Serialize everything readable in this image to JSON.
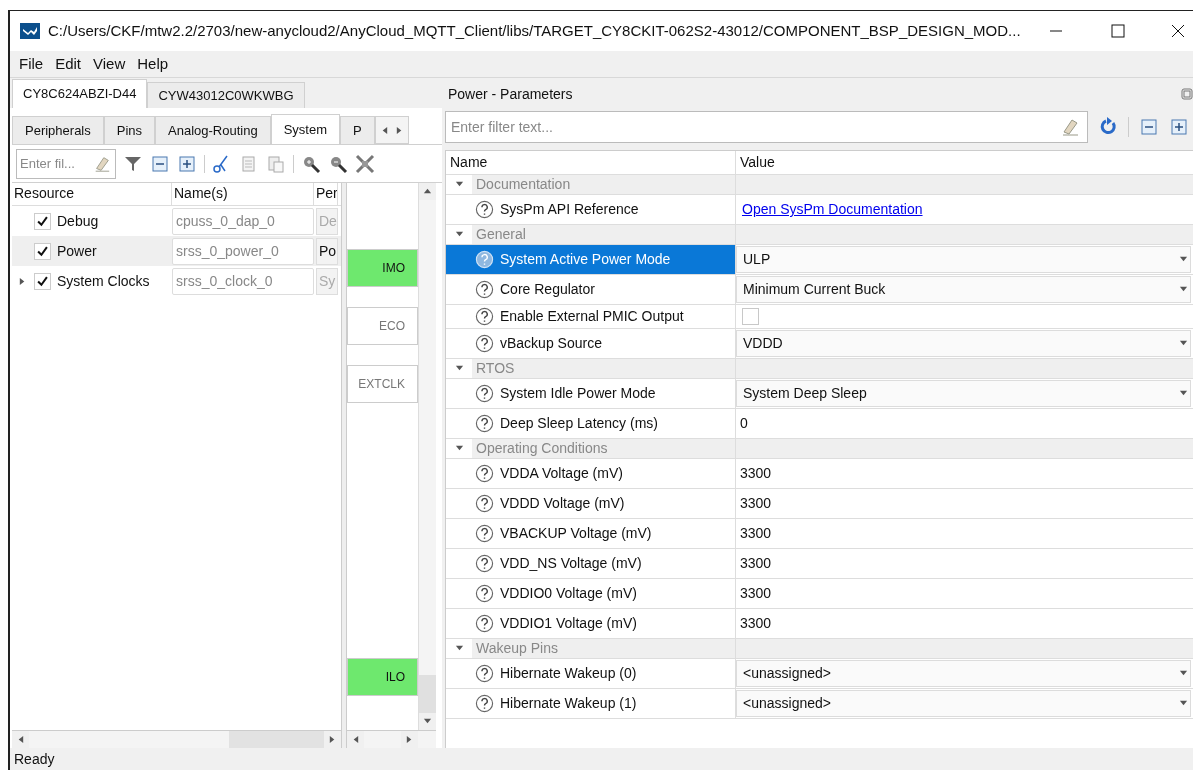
{
  "window": {
    "title": "C:/Users/CKF/mtw2.2/2703/new-anycloud2/AnyCloud_MQTT_Client/libs/TARGET_CY8CKIT-062S2-43012/COMPONENT_BSP_DESIGN_MOD..."
  },
  "menu": [
    "File",
    "Edit",
    "View",
    "Help"
  ],
  "device_tabs": [
    {
      "label": "CY8C624ABZI-D44",
      "selected": true
    },
    {
      "label": "CYW43012C0WKWBG",
      "selected": false
    }
  ],
  "view_tabs": [
    {
      "label": "Peripherals",
      "selected": false
    },
    {
      "label": "Pins",
      "selected": false
    },
    {
      "label": "Analog-Routing",
      "selected": false
    },
    {
      "label": "System",
      "selected": true
    },
    {
      "label": "P",
      "selected": false
    }
  ],
  "resource_filter": {
    "placeholder": "Enter fil..."
  },
  "resources": {
    "columns": [
      "Resource",
      "Name(s)",
      "Per"
    ],
    "rows": [
      {
        "name": "Debug",
        "instance": "cpuss_0_dap_0",
        "column_3": "De",
        "checked": true,
        "selected": false
      },
      {
        "name": "Power",
        "instance": "srss_0_power_0",
        "column_3": "Po",
        "checked": true,
        "selected": true
      },
      {
        "name": "System Clocks",
        "instance": "srss_0_clock_0",
        "column_3": "Sy",
        "checked": true,
        "selected": false,
        "expanded": false
      }
    ]
  },
  "clocks": [
    {
      "label": "IMO",
      "on": true
    },
    {
      "label": "ECO",
      "on": false
    },
    {
      "label": "EXTCLK",
      "on": false
    },
    {
      "label": "ILO",
      "on": true
    }
  ],
  "parameters": {
    "title": "Power - Parameters",
    "filter": {
      "placeholder": "Enter filter text..."
    },
    "columns": [
      "Name",
      "Value"
    ],
    "sections": [
      {
        "label": "Documentation",
        "expanded": true,
        "rows": [
          {
            "kind": "link",
            "name": "SysPm API Reference",
            "value": "Open SysPm Documentation",
            "selected": false
          }
        ]
      },
      {
        "label": "General",
        "expanded": true,
        "rows": [
          {
            "kind": "dropdown",
            "name": "System Active Power Mode",
            "value": "ULP",
            "selected": true
          },
          {
            "kind": "dropdown",
            "name": "Core Regulator",
            "value": "Minimum Current Buck",
            "selected": false
          },
          {
            "kind": "checkbox",
            "name": "Enable External PMIC Output",
            "checked": false,
            "selected": false
          },
          {
            "kind": "dropdown",
            "name": "vBackup Source",
            "value": "VDDD",
            "selected": false
          }
        ]
      },
      {
        "label": "RTOS",
        "expanded": true,
        "rows": [
          {
            "kind": "dropdown",
            "name": "System Idle Power Mode",
            "value": "System Deep Sleep",
            "selected": false
          },
          {
            "kind": "text",
            "name": "Deep Sleep Latency (ms)",
            "value": "0",
            "selected": false
          }
        ]
      },
      {
        "label": "Operating Conditions",
        "expanded": true,
        "rows": [
          {
            "kind": "text",
            "name": "VDDA Voltage (mV)",
            "value": "3300",
            "selected": false
          },
          {
            "kind": "text",
            "name": "VDDD Voltage (mV)",
            "value": "3300",
            "selected": false
          },
          {
            "kind": "text",
            "name": "VBACKUP Voltage (mV)",
            "value": "3300",
            "selected": false
          },
          {
            "kind": "text",
            "name": "VDD_NS Voltage (mV)",
            "value": "3300",
            "selected": false
          },
          {
            "kind": "text",
            "name": "VDDIO0 Voltage (mV)",
            "value": "3300",
            "selected": false
          },
          {
            "kind": "text",
            "name": "VDDIO1 Voltage (mV)",
            "value": "3300",
            "selected": false
          }
        ]
      },
      {
        "label": "Wakeup Pins",
        "expanded": true,
        "rows": [
          {
            "kind": "dropdown",
            "name": "Hibernate Wakeup (0)",
            "value": "<unassigned>",
            "selected": false
          },
          {
            "kind": "dropdown",
            "name": "Hibernate Wakeup (1)",
            "value": "<unassigned>",
            "selected": false
          }
        ]
      }
    ]
  },
  "status_bar": "Ready"
}
